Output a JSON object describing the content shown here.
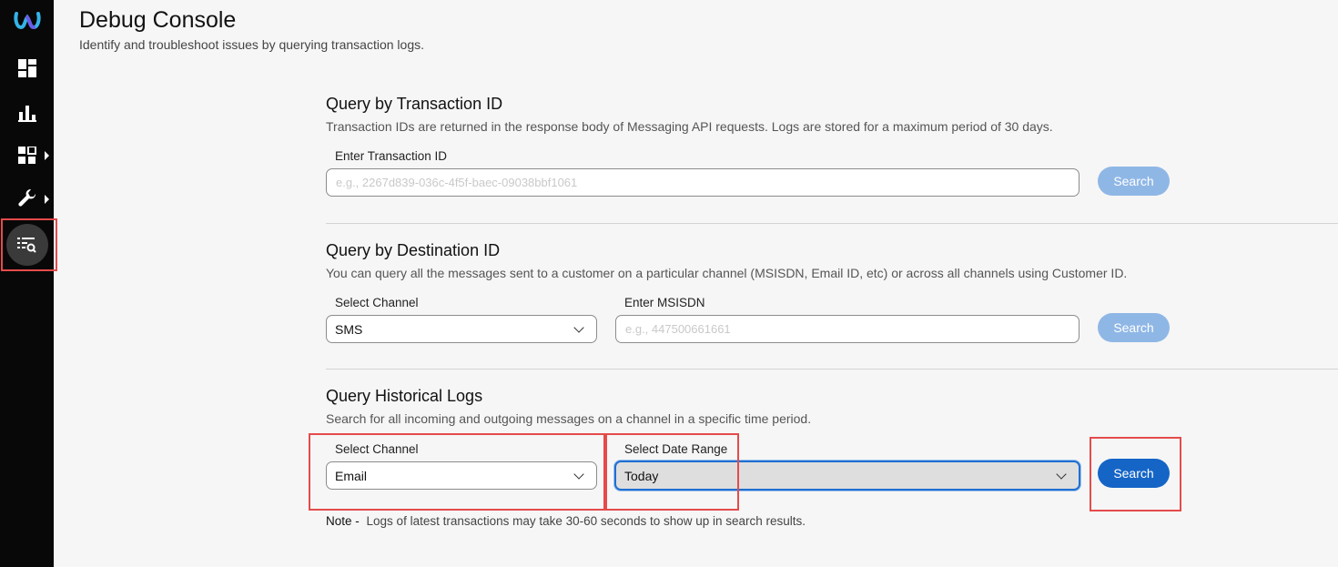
{
  "header": {
    "title": "Debug Console",
    "subtitle": "Identify and troubleshoot issues by querying transaction logs."
  },
  "sidebar": {
    "items": [
      {
        "icon": "webex-logo-icon"
      },
      {
        "icon": "dashboard-icon"
      },
      {
        "icon": "analytics-icon"
      },
      {
        "icon": "apps-icon",
        "has_submenu": true
      },
      {
        "icon": "wrench-icon",
        "has_submenu": true
      },
      {
        "icon": "debug-console-icon",
        "active": true
      }
    ]
  },
  "transaction": {
    "title": "Query by Transaction ID",
    "description": "Transaction IDs are returned in the response body of Messaging API requests. Logs are stored for a maximum period of 30 days.",
    "input_label": "Enter Transaction ID",
    "input_placeholder": "e.g., 2267d839-036c-4f5f-baec-09038bbf1061",
    "search_label": "Search"
  },
  "destination": {
    "title": "Query by Destination ID",
    "description": "You can query all the messages sent to a customer on a particular channel (MSISDN, Email ID, etc) or across all channels using Customer ID.",
    "channel_label": "Select Channel",
    "channel_value": "SMS",
    "input_label": "Enter MSISDN",
    "input_placeholder": "e.g., 447500661661",
    "search_label": "Search"
  },
  "historical": {
    "title": "Query Historical Logs",
    "description": "Search for all incoming and outgoing messages on a channel in a specific time period.",
    "channel_label": "Select Channel",
    "channel_value": "Email",
    "date_label": "Select Date Range",
    "date_value": "Today",
    "search_label": "Search",
    "note_label": "Note -",
    "note_text": "Logs of latest transactions may take 30-60 seconds to show up in search results."
  },
  "colors": {
    "sidebar_bg": "#080808",
    "primary": "#1565c6",
    "disabled": "#8fb7e6",
    "highlight": "#e54b4b"
  }
}
